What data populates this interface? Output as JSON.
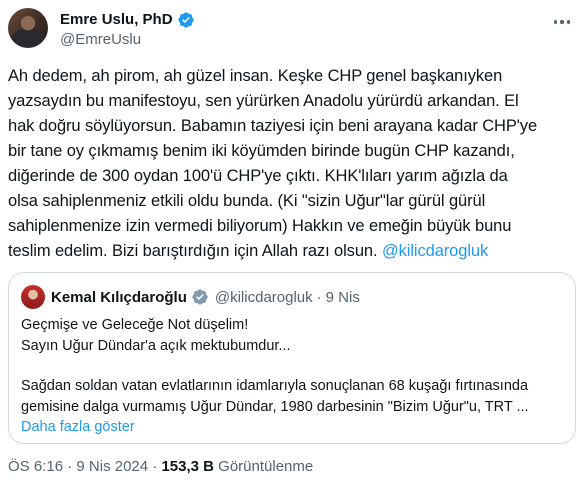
{
  "author": {
    "display_name": "Emre Uslu, PhD",
    "handle": "@EmreUslu",
    "verified": true
  },
  "tweet": {
    "lines": [
      "Ah dedem, ah pirom, ah güzel insan. Keşke CHP genel başkanıyken",
      "yazsaydın bu manifestoyu, sen yürürken Anadolu yürürdü arkandan. El",
      "hak doğru söylüyorsun. Babamın taziyesi için beni arayana kadar CHP'ye",
      "bir tane oy çıkmamış benim iki köyümden birinde bugün CHP kazandı,",
      "diğerinde de 300 oydan 100'ü CHP'ye çıktı. KHK'lıları yarım ağızla da",
      "olsa sahiplenmeniz etkili oldu bunda.  (Ki \"sizin Uğur\"lar gürül gürül",
      "sahiplenmenize izin vermedi biliyorum) Hakkın ve emeğin büyük bunu",
      "teslim edelim. Bizi barıştırdığın için Allah razı olsun. "
    ],
    "mention": "@kilicdarogluk"
  },
  "quoted": {
    "display_name": "Kemal Kılıçdaroğlu",
    "verified": true,
    "handle": "@kilicdarogluk",
    "separator": "·",
    "time": "9 Nis",
    "lines_a": [
      "Geçmişe ve Geleceğe Not düşelim!",
      "Sayın Uğur Dündar'a açık mektubumdur..."
    ],
    "lines_b": [
      "Sağdan soldan vatan evlatlarının idamlarıyla sonuçlanan 68 kuşağı fırtınasında",
      "gemisine dalga vurmamış Uğur Dündar, 1980 darbesinin \"Bizim Uğur\"u, TRT ..."
    ],
    "show_more": "Daha fazla göster"
  },
  "meta": {
    "time": "ÖS 6:16",
    "separator": "·",
    "date": "9 Nis 2024",
    "views_count": "153,3 B",
    "views_label": "Görüntülenme"
  },
  "colors": {
    "accent": "#1d9bf0",
    "text": "#0f1419",
    "secondary": "#536471",
    "border": "#cfd9de"
  },
  "icons": {
    "verified": "verified-badge-icon",
    "more": "more-options-icon"
  }
}
